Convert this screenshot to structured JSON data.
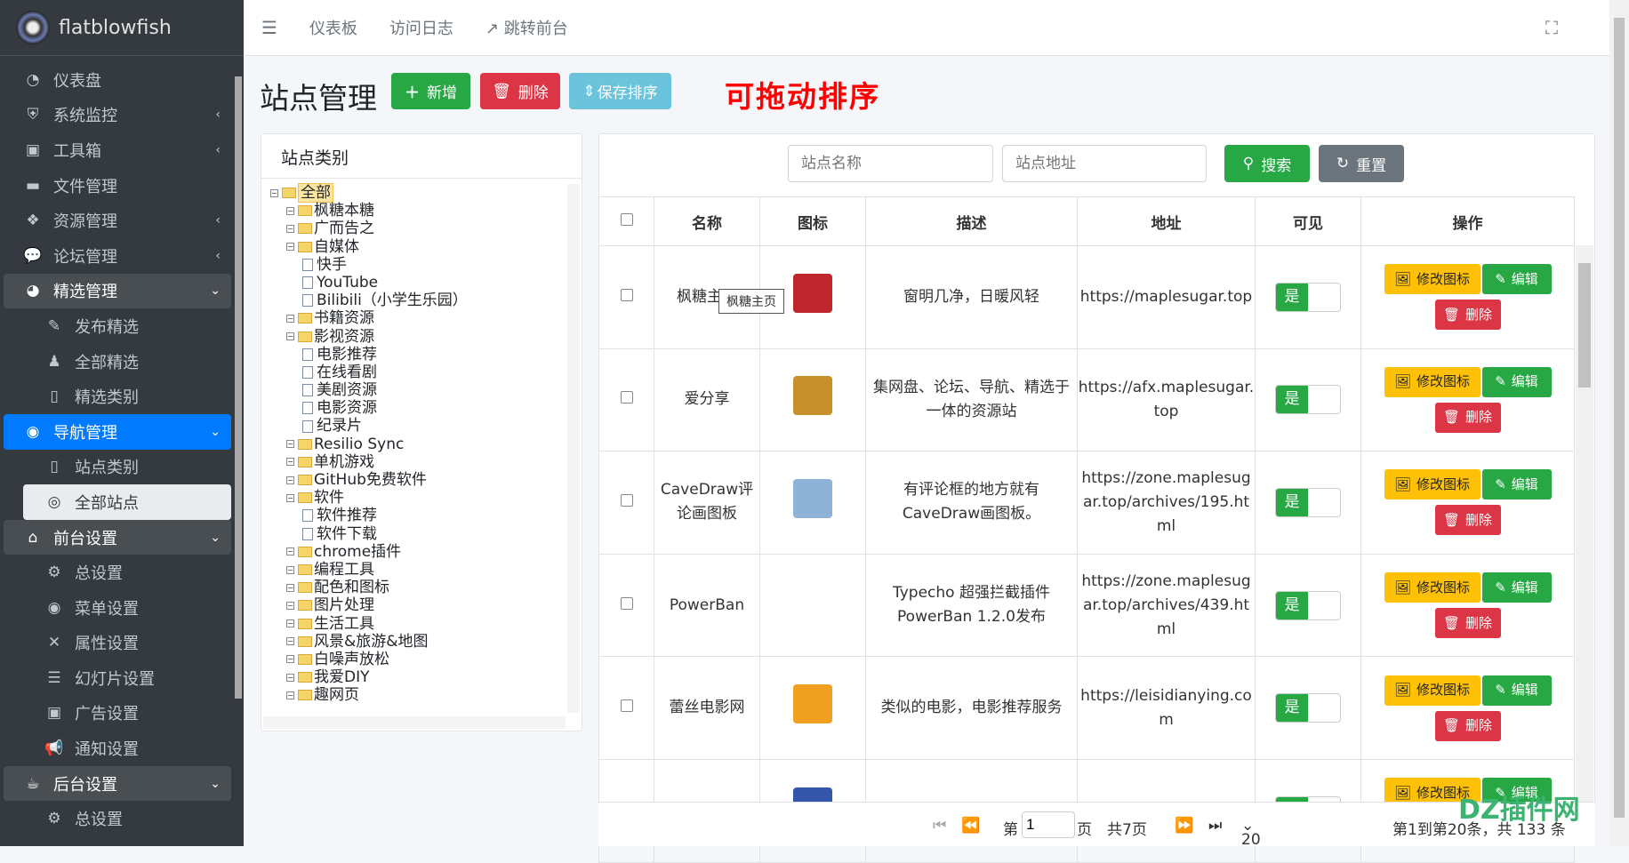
{
  "brand": "flatblowfish",
  "sidebar": [
    {
      "label": "仪表盘",
      "icon": "dashboard-icon",
      "g": "◔"
    },
    {
      "label": "系统监控",
      "icon": "shield-icon",
      "g": "⛨",
      "chev": "‹"
    },
    {
      "label": "工具箱",
      "icon": "toolbox-icon",
      "g": "▣",
      "chev": "‹"
    },
    {
      "label": "文件管理",
      "icon": "folder-icon",
      "g": "▬"
    },
    {
      "label": "资源管理",
      "icon": "cubes-icon",
      "g": "❖",
      "chev": "‹"
    },
    {
      "label": "论坛管理",
      "icon": "comments-icon",
      "g": "💬",
      "chev": "‹"
    },
    {
      "label": "精选管理",
      "icon": "cookie-icon",
      "g": "◕",
      "chev": "⌄",
      "state": "open"
    },
    {
      "label": "发布精选",
      "icon": "feather-icon",
      "g": "✎",
      "sub": true
    },
    {
      "label": "全部精选",
      "icon": "chess-icon",
      "g": "♟",
      "sub": true
    },
    {
      "label": "精选类别",
      "icon": "bookmark-icon",
      "g": "▯",
      "sub": true
    },
    {
      "label": "导航管理",
      "icon": "compass-icon",
      "g": "◉",
      "chev": "⌄",
      "state": "active"
    },
    {
      "label": "站点类别",
      "icon": "bookmark-icon",
      "g": "▯",
      "sub": true
    },
    {
      "label": "全部站点",
      "icon": "chrome-icon",
      "g": "◎",
      "sub": true,
      "state": "cur"
    },
    {
      "label": "前台设置",
      "icon": "home-icon",
      "g": "⌂",
      "chev": "⌄",
      "state": "open"
    },
    {
      "label": "总设置",
      "icon": "gear-icon",
      "g": "⚙",
      "sub": true
    },
    {
      "label": "菜单设置",
      "icon": "compass-icon",
      "g": "◉",
      "sub": true
    },
    {
      "label": "属性设置",
      "icon": "tools-icon",
      "g": "✕",
      "sub": true
    },
    {
      "label": "幻灯片设置",
      "icon": "sliders-icon",
      "g": "☰",
      "sub": true
    },
    {
      "label": "广告设置",
      "icon": "ad-icon",
      "g": "▣",
      "sub": true
    },
    {
      "label": "通知设置",
      "icon": "bullhorn-icon",
      "g": "📢",
      "sub": true
    },
    {
      "label": "后台设置",
      "icon": "coffee-icon",
      "g": "☕",
      "chev": "⌄",
      "state": "open"
    },
    {
      "label": "总设置",
      "icon": "gear-icon",
      "g": "⚙",
      "sub": true
    }
  ],
  "header": {
    "menu": "☰",
    "links": [
      "仪表板",
      "访问日志",
      "↗ 跳转前台"
    ]
  },
  "page": {
    "title": "站点管理",
    "add": "新增",
    "delete": "删除",
    "save_order": "保存排序",
    "note": "可拖动排序"
  },
  "tree": {
    "title": "站点类别",
    "nodes": [
      {
        "l": "全部",
        "d": 0,
        "f": 1,
        "sel": 1
      },
      {
        "l": "枫糖本糖",
        "d": 1,
        "f": 1
      },
      {
        "l": "广而告之",
        "d": 1,
        "f": 1
      },
      {
        "l": "自媒体",
        "d": 1,
        "f": 1
      },
      {
        "l": "快手",
        "d": 2
      },
      {
        "l": "YouTube",
        "d": 2
      },
      {
        "l": "Bilibili（小学生乐园）",
        "d": 2
      },
      {
        "l": "书籍资源",
        "d": 1,
        "f": 1
      },
      {
        "l": "影视资源",
        "d": 1,
        "f": 1
      },
      {
        "l": "电影推荐",
        "d": 2
      },
      {
        "l": "在线看剧",
        "d": 2
      },
      {
        "l": "美剧资源",
        "d": 2
      },
      {
        "l": "电影资源",
        "d": 2
      },
      {
        "l": "纪录片",
        "d": 2
      },
      {
        "l": "Resilio Sync",
        "d": 1,
        "f": 1
      },
      {
        "l": "单机游戏",
        "d": 1,
        "f": 1
      },
      {
        "l": "GitHub免费软件",
        "d": 1,
        "f": 1
      },
      {
        "l": "软件",
        "d": 1,
        "f": 1
      },
      {
        "l": "软件推荐",
        "d": 2
      },
      {
        "l": "软件下载",
        "d": 2
      },
      {
        "l": "chrome插件",
        "d": 1,
        "f": 1
      },
      {
        "l": "编程工具",
        "d": 1,
        "f": 1
      },
      {
        "l": "配色和图标",
        "d": 1,
        "f": 1
      },
      {
        "l": "图片处理",
        "d": 1,
        "f": 1
      },
      {
        "l": "生活工具",
        "d": 1,
        "f": 1
      },
      {
        "l": "风景&旅游&地图",
        "d": 1,
        "f": 1
      },
      {
        "l": "白噪声放松",
        "d": 1,
        "f": 1
      },
      {
        "l": "我爱DIY",
        "d": 1,
        "f": 1
      },
      {
        "l": "趣网页",
        "d": 1,
        "f": 1
      }
    ]
  },
  "search": {
    "name_ph": "站点名称",
    "url_ph": "站点地址",
    "search": "搜索",
    "reset": "重置"
  },
  "table": {
    "headers": [
      "名称",
      "图标",
      "描述",
      "地址",
      "可见",
      "操作"
    ],
    "rows": [
      {
        "name": "枫糖主页",
        "desc": "窗明几净，日暖风轻",
        "url": "https://maplesugar.top",
        "vis": "是",
        "color": "#c0262d"
      },
      {
        "name": "爱分享",
        "desc": "集网盘、论坛、导航、精选于一体的资源站",
        "url": "https://afx.maplesugar.top",
        "vis": "是",
        "color": "#c8902a"
      },
      {
        "name": "CaveDraw评论画图板",
        "desc": "有评论框的地方就有CaveDraw画图板。",
        "url": "https://zone.maplesugar.top/archives/195.html",
        "vis": "是",
        "color": "#8fb3d6"
      },
      {
        "name": "PowerBan",
        "desc": "Typecho 超强拦截插件 PowerBan 1.2.0发布",
        "url": "https://zone.maplesugar.top/archives/439.html",
        "vis": "是",
        "color": "#ffffff"
      },
      {
        "name": "蕾丝电影网",
        "desc": "类似的电影，电影推荐服务",
        "url": "https://leisidianying.com",
        "vis": "是",
        "color": "#f0a020"
      },
      {
        "name": "",
        "desc": "",
        "url": "",
        "vis": "是",
        "color": "#3355aa"
      }
    ],
    "ops": {
      "change_icon": "修改图标",
      "edit": "编辑",
      "delete": "删除"
    },
    "tooltip": "枫糖主页"
  },
  "pager": {
    "page_prefix": "第",
    "page": "1",
    "page_suffix": "页",
    "total_pages": "共7页",
    "size": "20",
    "summary": "第1到第20条，共 133 条"
  },
  "watermark": "DZ插件网"
}
